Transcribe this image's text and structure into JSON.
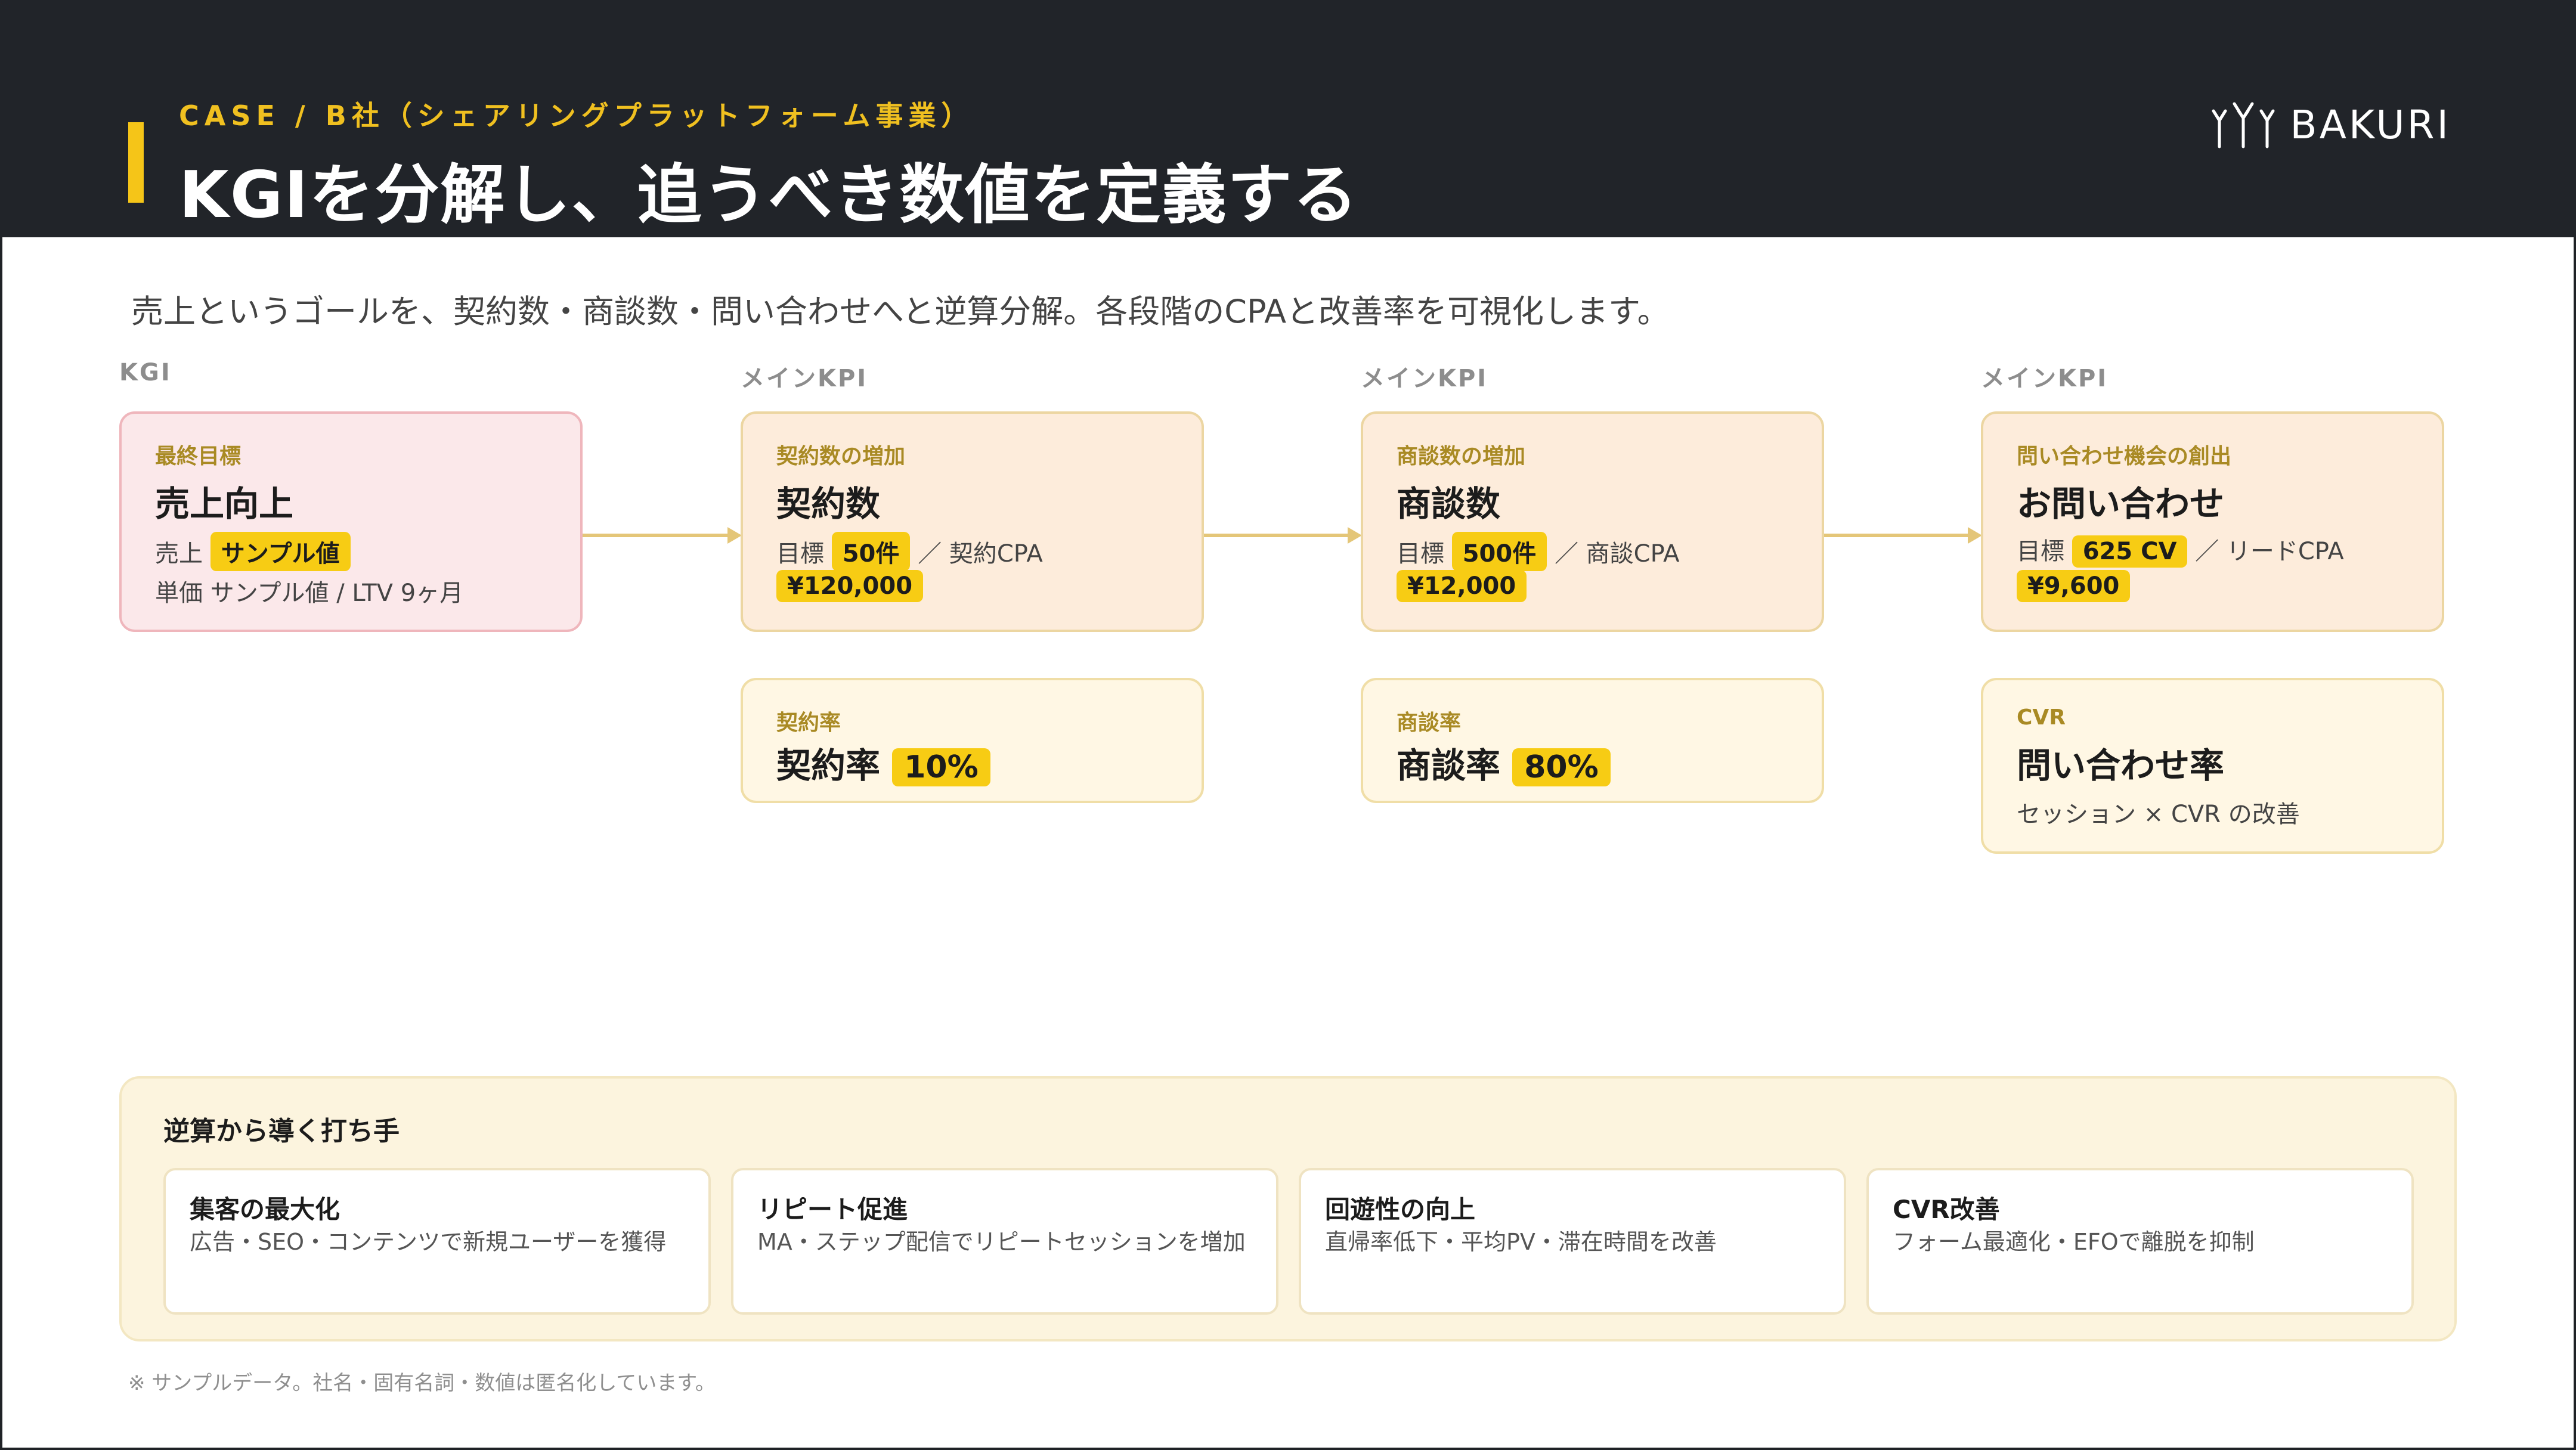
{
  "header": {
    "eyebrow": "CASE / B社（シェアリングプラットフォーム事業）",
    "title": "KGIを分解し、追うべき数値を定義する",
    "brand": "BAKURI"
  },
  "subtitle": "売上というゴールを、契約数・商談数・問い合わせへと逆算分解。各段階のCPAと改善率を可視化します。",
  "stages": [
    {
      "label": "KGI",
      "main": {
        "eyebrow": "最終目標",
        "heading": "売上向上",
        "line1_prefix": "売上",
        "line1_value": "サンプル値",
        "line2": "単価 サンプル値 / LTV 9ヶ月"
      }
    },
    {
      "label": "メインKPI",
      "main": {
        "eyebrow": "契約数の増加",
        "heading": "契約数",
        "target_prefix": "目標",
        "target_value": "50件",
        "cpa_label": "／ 契約CPA",
        "cpa_value": "¥120,000"
      },
      "sub": {
        "eyebrow": "契約率",
        "heading": "契約率",
        "value": "10%"
      }
    },
    {
      "label": "メインKPI",
      "main": {
        "eyebrow": "商談数の増加",
        "heading": "商談数",
        "target_prefix": "目標",
        "target_value": "500件",
        "cpa_label": "／ 商談CPA",
        "cpa_value": "¥12,000"
      },
      "sub": {
        "eyebrow": "商談率",
        "heading": "商談率",
        "value": "80%"
      }
    },
    {
      "label": "メインKPI",
      "main": {
        "eyebrow": "問い合わせ機会の創出",
        "heading": "お問い合わせ",
        "target_prefix": "目標",
        "target_value": "625 CV",
        "cpa_label": "／ リードCPA",
        "cpa_value": "¥9,600"
      },
      "sub": {
        "eyebrow": "CVR",
        "heading": "問い合わせ率",
        "note": "セッション × CVR の改善"
      }
    }
  ],
  "tactics": {
    "title": "逆算から導く打ち手",
    "items": [
      {
        "title": "集客の最大化",
        "desc": "広告・SEO・コンテンツで新規ユーザーを獲得"
      },
      {
        "title": "リピート促進",
        "desc": "MA・ステップ配信でリピートセッションを増加"
      },
      {
        "title": "回遊性の向上",
        "desc": "直帰率低下・平均PV・滞在時間を改善"
      },
      {
        "title": "CVR改善",
        "desc": "フォーム最適化・EFOで離脱を抑制"
      }
    ]
  },
  "footnote": "※ サンプルデータ。社名・固有名詞・数値は匿名化しています。",
  "colors": {
    "header_bg": "#212429",
    "accent": "#f7cc14",
    "kgi_card": "#fbe8ea",
    "kpi_card": "#fdecdb",
    "sub_card": "#fff7e4"
  }
}
